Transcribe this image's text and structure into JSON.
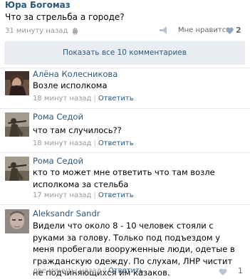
{
  "post": {
    "author": "Юра Богомаз",
    "text": "Что за стрельба а городе?",
    "time": "31 минуту назад",
    "like_label": "Мне нравится",
    "like_count": "2"
  },
  "show_all_label": "Показать все 10 комментариев",
  "comments": [
    {
      "author": "Алёна Колесникова",
      "text": "Возле исполкома",
      "time": "18 минут назад",
      "reply_label": "Ответить"
    },
    {
      "author": "Рома Седой",
      "text": "что там случилось??",
      "time": "18 минут назад",
      "reply_label": "Ответить"
    },
    {
      "author": "Рома Седой",
      "text": "кто то может мне ответить что там возле исполкома за стельба",
      "time": "17 минут назад",
      "reply_label": "Ответить"
    },
    {
      "author": "Aleksandr Sandr",
      "text": "Видели что около 8 - 10 человек стояли с руками за голову. Только под подъездом у меня пробегали вооруженные люди, одетые в гражданскую одежду. По слухам, ЛНР чистит не подчиняющихся им казаков.",
      "time": "две минуты назад",
      "reply_label": "Ответить",
      "like_count": "1"
    }
  ]
}
